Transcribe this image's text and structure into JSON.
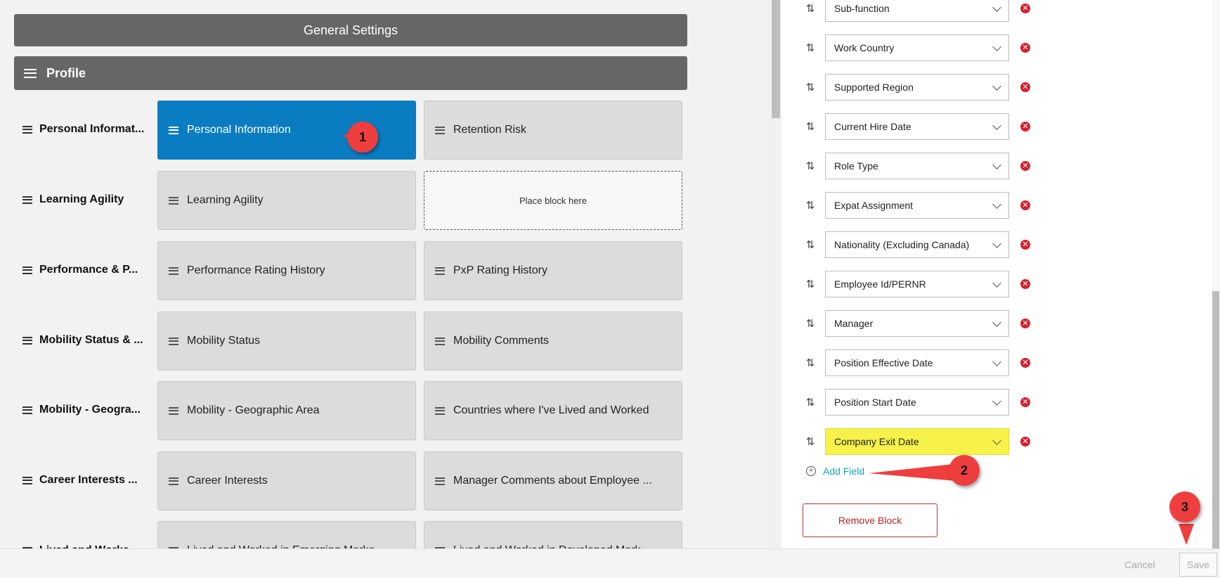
{
  "general_settings_title": "General Settings",
  "profile_title": "Profile",
  "rows": [
    {
      "label": "Personal Informat...",
      "blocks": [
        "Personal Information",
        "Retention Risk"
      ]
    },
    {
      "label": "Learning Agility",
      "blocks": [
        "Learning Agility",
        "Place block here"
      ]
    },
    {
      "label": "Performance & P...",
      "blocks": [
        "Performance Rating History",
        "PxP Rating History"
      ]
    },
    {
      "label": "Mobility Status & ...",
      "blocks": [
        "Mobility Status",
        "Mobility Comments"
      ]
    },
    {
      "label": "Mobility - Geogra...",
      "blocks": [
        "Mobility - Geographic Area",
        "Countries where I've Lived and Worked"
      ]
    },
    {
      "label": "Career Interests ...",
      "blocks": [
        "Career Interests",
        "Manager Comments about Employee ..."
      ]
    },
    {
      "label": "Lived and Worke...",
      "blocks": [
        "Lived and Worked in Emerging Market...",
        "Lived and Worked in Developed Market..."
      ]
    }
  ],
  "fields": [
    "Sub-function",
    "Work Country",
    "Supported Region",
    "Current Hire Date",
    "Role Type",
    "Expat Assignment",
    "Nationality (Excluding Canada)",
    "Employee Id/PERNR",
    "Manager",
    "Position Effective Date",
    "Position Start Date",
    "Company Exit Date"
  ],
  "add_field_label": "Add Field",
  "remove_block_label": "Remove Block",
  "cancel_label": "Cancel",
  "save_label": "Save",
  "callouts": [
    "1",
    "2",
    "3"
  ],
  "colors": {
    "active_block": "#0a7cc1",
    "highlight": "#f6f24a",
    "callout": "#ef3e3e",
    "delete": "#d6202c",
    "link": "#19a2b8"
  }
}
